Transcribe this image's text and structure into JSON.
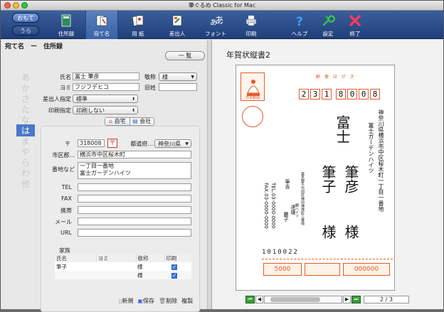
{
  "window": {
    "title": "筆ぐるめ Classic for Mac"
  },
  "toolbar": {
    "seg_omote": "おもて",
    "seg_ura": "うら",
    "items": [
      {
        "label": "住所録"
      },
      {
        "label": "宛て名"
      },
      {
        "label": "用 紙"
      },
      {
        "label": "差出人"
      },
      {
        "label": "フォント"
      },
      {
        "label": "印刷"
      },
      {
        "label": "ヘルプ"
      },
      {
        "label": "設定"
      },
      {
        "label": "終了"
      }
    ]
  },
  "left": {
    "heading": "宛て名　ー　住所録",
    "list_button": "一 覧",
    "kana": [
      "あ",
      "か",
      "さ",
      "た",
      "な",
      "は",
      "ま",
      "や",
      "ら",
      "わ",
      "他"
    ],
    "kana_selected": "は",
    "name_label": "氏名",
    "name_value": "富士 筆彦",
    "title_label": "敬称",
    "title_value": "様",
    "yomi_label": "ヨミ",
    "yomi_value": "フジフデヒコ",
    "kyusei_label": "旧姓",
    "kyusei_value": "",
    "sender_label": "差出人指定",
    "sender_value": "標準",
    "print_label": "印刷指定",
    "print_value": "印刷しない",
    "tab_home": "自宅",
    "tab_company": "会社",
    "zip_label": "〒",
    "zip_value": "318008",
    "pref_label": "都道府...",
    "pref_value": "神奈川県",
    "city_label": "市区郡...",
    "city_value": "横浜市中区桜木町",
    "addr_label": "番地など",
    "addr_line1": "一丁目一番地",
    "addr_line2": "富士ガーデンハイツ",
    "tel_label": "TEL",
    "fax_label": "FAX",
    "mobile_label": "携帯",
    "mail_label": "メール",
    "url_label": "URL",
    "family_label": "家族",
    "family_headers": [
      "氏名",
      "ヨミ",
      "敬称",
      "印刷"
    ],
    "family_rows": [
      {
        "name": "筆子",
        "yomi": "",
        "title": "様",
        "print": true
      },
      {
        "name": "",
        "yomi": "",
        "title": "様",
        "print": true
      }
    ],
    "actions": {
      "new": "新規",
      "save": "保存",
      "delete": "削除",
      "copy": "複製"
    }
  },
  "right": {
    "title": "年賀状縦書2",
    "page": "2 / 3",
    "hagaki_label": "郵 便 は が き",
    "zip_top": [
      "2",
      "3",
      "1"
    ],
    "zip_bottom": [
      "8",
      "0",
      "0",
      "8"
    ],
    "address_line1": "神奈川県横浜市中区桜木町一丁目一番地",
    "address_line2": "富士ガーデンハイツ",
    "recipient1": "富士",
    "recipient2": "筆彦",
    "recipient3": "筆子",
    "honorific1": "様",
    "honorific2": "様",
    "sender_address": "東京都千代田区神田神保町三番地",
    "sender_building": "錦ハイツ",
    "sender_name1": "筆吉",
    "sender_name2": "達雄",
    "sender_name3": "麗子",
    "sender_tel": "TEL.03-0000-0000",
    "sender_fax": "FAX.03-0000-0000",
    "sender_zip": "1010022",
    "stamp_label": "日本郵便",
    "lottery1": "5000",
    "lottery2": "000000"
  },
  "colors": {
    "accent": "#e55a2a",
    "toolbar": "#2a4c88",
    "selected": "#4a78c8"
  }
}
